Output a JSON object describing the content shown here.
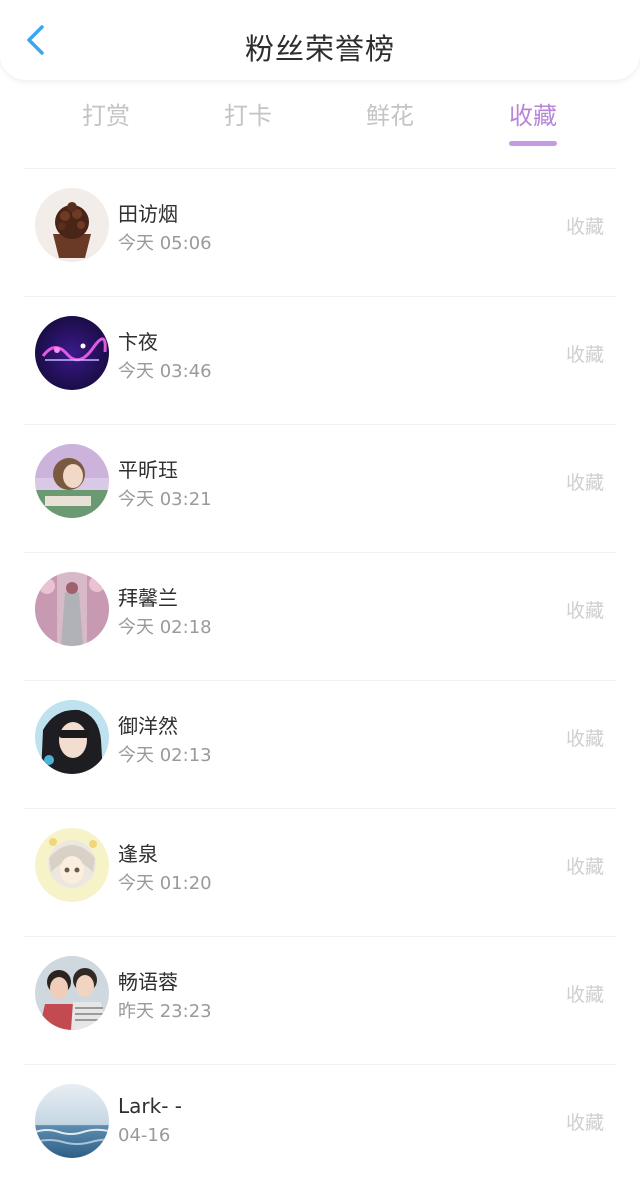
{
  "header": {
    "title": "粉丝荣誉榜",
    "back_icon": "chevron-left-icon",
    "accent_color": "#3aa6f0"
  },
  "tabs": [
    {
      "label": "打赏",
      "active": false
    },
    {
      "label": "打卡",
      "active": false
    },
    {
      "label": "鲜花",
      "active": false
    },
    {
      "label": "收藏",
      "active": true
    }
  ],
  "tab_active_color": "#b687d9",
  "list": [
    {
      "name": "田访烟",
      "time": "今天 05:06",
      "action": "收藏"
    },
    {
      "name": "卞夜",
      "time": "今天 03:46",
      "action": "收藏"
    },
    {
      "name": "平昕珏",
      "time": "今天 03:21",
      "action": "收藏"
    },
    {
      "name": "拜馨兰",
      "time": "今天 02:18",
      "action": "收藏"
    },
    {
      "name": "御洋然",
      "time": "今天 02:13",
      "action": "收藏"
    },
    {
      "name": "逢泉",
      "time": "今天 01:20",
      "action": "收藏"
    },
    {
      "name": "畅语蓉",
      "time": "昨天 23:23",
      "action": "收藏"
    },
    {
      "name": "Lark- -",
      "time": "04-16",
      "action": "收藏"
    }
  ]
}
